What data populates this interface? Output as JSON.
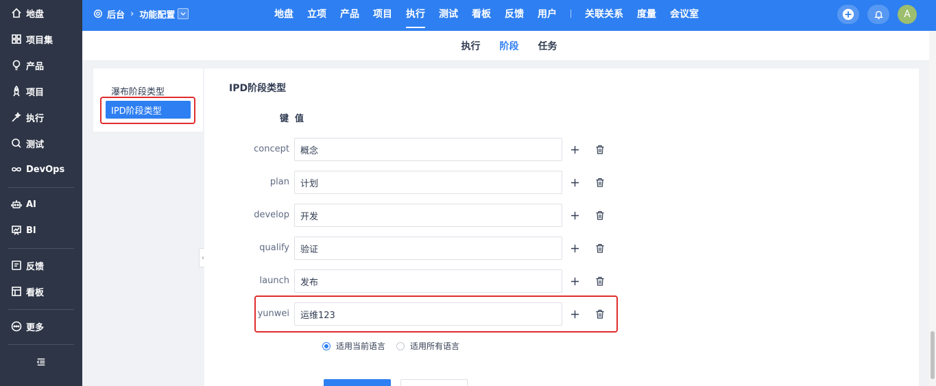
{
  "leftnav": {
    "items": [
      {
        "label": "地盘",
        "icon": "home-icon"
      },
      {
        "label": "项目集",
        "icon": "grid-icon"
      },
      {
        "label": "产品",
        "icon": "bulb-icon"
      },
      {
        "label": "项目",
        "icon": "rocket-icon"
      },
      {
        "label": "执行",
        "icon": "wand-icon"
      },
      {
        "label": "测试",
        "icon": "search-icon"
      },
      {
        "label": "DevOps",
        "icon": "infinity-icon"
      },
      {
        "label": "AI",
        "icon": "robot-icon"
      },
      {
        "label": "BI",
        "icon": "chart-board-icon"
      },
      {
        "label": "反馈",
        "icon": "feedback-icon"
      },
      {
        "label": "看板",
        "icon": "kanban-icon"
      },
      {
        "label": "更多",
        "icon": "more-icon"
      }
    ]
  },
  "topbar": {
    "breadcrumb_root": "后台",
    "breadcrumb_current": "功能配置",
    "nav": [
      "地盘",
      "立项",
      "产品",
      "项目",
      "执行",
      "测试",
      "看板",
      "反馈",
      "用户",
      "关联关系",
      "度量",
      "会议室"
    ],
    "active_nav": "执行",
    "avatar": "A",
    "accent": "#2e7ff1"
  },
  "subnav": {
    "items": [
      "执行",
      "阶段",
      "任务"
    ],
    "active": "阶段"
  },
  "sidepanel": {
    "items": [
      "瀑布阶段类型",
      "IPD阶段类型"
    ],
    "active": "IPD阶段类型"
  },
  "content": {
    "title": "IPD阶段类型",
    "header_key": "键",
    "header_value": "值",
    "rows": [
      {
        "key": "concept",
        "value": "概念"
      },
      {
        "key": "plan",
        "value": "计划"
      },
      {
        "key": "develop",
        "value": "开发"
      },
      {
        "key": "qualify",
        "value": "验证"
      },
      {
        "key": "launch",
        "value": "发布"
      },
      {
        "key": "yunwei",
        "value": "运维123"
      }
    ],
    "radio_current": "适用当前语言",
    "radio_all": "适用所有语言",
    "radio_selected": "适用当前语言"
  }
}
